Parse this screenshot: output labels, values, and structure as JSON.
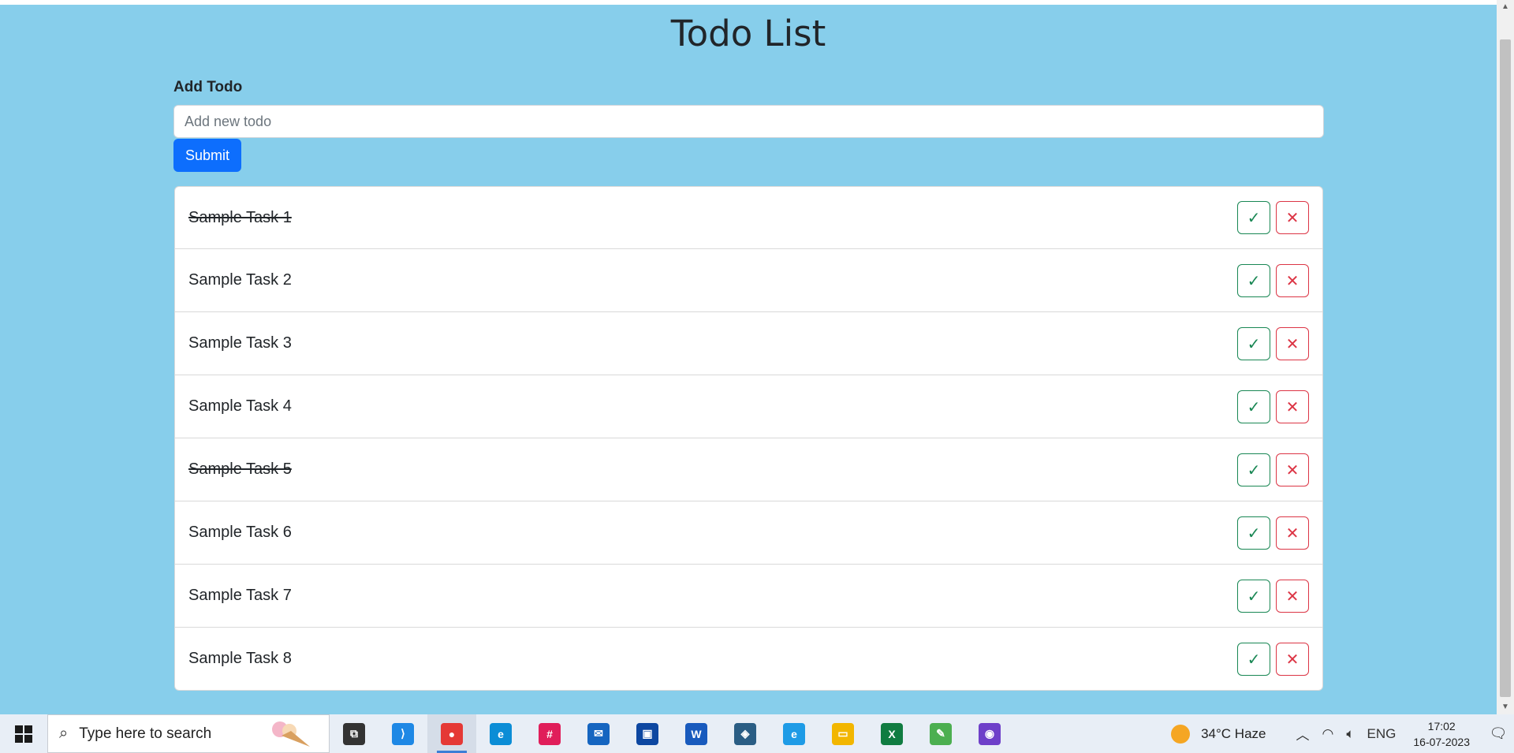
{
  "page": {
    "title": "Todo List",
    "add_label": "Add Todo",
    "input_placeholder": "Add new todo",
    "submit_label": "Submit"
  },
  "todos": [
    {
      "text": "Sample Task 1",
      "done": true
    },
    {
      "text": "Sample Task 2",
      "done": false
    },
    {
      "text": "Sample Task 3",
      "done": false
    },
    {
      "text": "Sample Task 4",
      "done": false
    },
    {
      "text": "Sample Task 5",
      "done": true
    },
    {
      "text": "Sample Task 6",
      "done": false
    },
    {
      "text": "Sample Task 7",
      "done": false
    },
    {
      "text": "Sample Task 8",
      "done": false
    }
  ],
  "buttons": {
    "check_glyph": "✓",
    "delete_glyph": "✕"
  },
  "colors": {
    "background": "#87ceeb",
    "primary": "#0d6efd",
    "success": "#198754",
    "danger": "#dc3545"
  },
  "taskbar": {
    "search_placeholder": "Type here to search",
    "apps": [
      {
        "name": "task-view-icon",
        "color": "#333333",
        "glyph": "⧉"
      },
      {
        "name": "vscode-icon",
        "color": "#1e88e5",
        "glyph": "⟩"
      },
      {
        "name": "chrome-icon",
        "color": "#e53935",
        "glyph": "●",
        "active": true
      },
      {
        "name": "edge-icon",
        "color": "#0b8dd6",
        "glyph": "e"
      },
      {
        "name": "slack-icon",
        "color": "#e01e5a",
        "glyph": "#"
      },
      {
        "name": "mail-icon",
        "color": "#1565c0",
        "glyph": "✉"
      },
      {
        "name": "store-icon",
        "color": "#0d47a1",
        "glyph": "▣"
      },
      {
        "name": "word-icon",
        "color": "#185abd",
        "glyph": "W"
      },
      {
        "name": "mysql-workbench-icon",
        "color": "#2a5d84",
        "glyph": "◈"
      },
      {
        "name": "internet-explorer-icon",
        "color": "#1e9be6",
        "glyph": "e"
      },
      {
        "name": "file-explorer-icon",
        "color": "#f2b600",
        "glyph": "▭"
      },
      {
        "name": "excel-icon",
        "color": "#107c41",
        "glyph": "X"
      },
      {
        "name": "editor-icon",
        "color": "#4caf50",
        "glyph": "✎"
      },
      {
        "name": "github-desktop-icon",
        "color": "#6e40c9",
        "glyph": "◉"
      }
    ],
    "weather_text": "34°C  Haze",
    "language": "ENG",
    "time": "17:02",
    "date": "16-07-2023"
  }
}
